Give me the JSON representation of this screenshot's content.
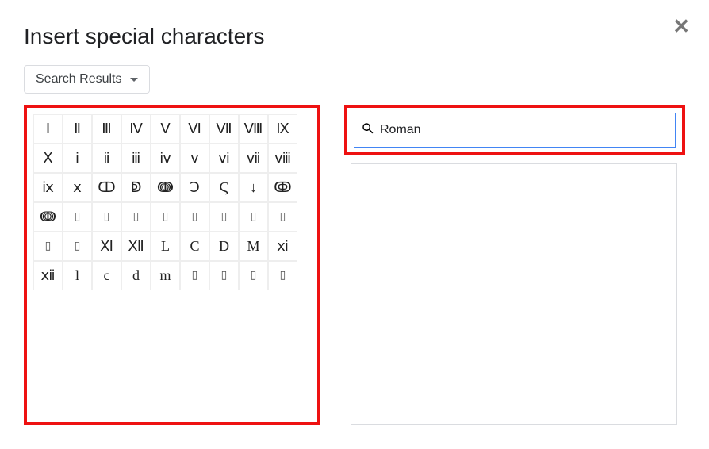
{
  "header": {
    "title": "Insert special characters"
  },
  "dropdown": {
    "label": "Search Results"
  },
  "search": {
    "value": "Roman",
    "placeholder": ""
  },
  "characters": {
    "row1": [
      "Ⅰ",
      "Ⅱ",
      "Ⅲ",
      "Ⅳ",
      "Ⅴ",
      "Ⅵ",
      "Ⅶ",
      "Ⅷ",
      "Ⅸ",
      "Ⅹ"
    ],
    "row2": [
      "ⅰ",
      "ⅱ",
      "ⅲ",
      "ⅳ",
      "ⅴ",
      "ⅵ",
      "ⅶ",
      "ⅷ",
      "ⅸ",
      "ⅹ"
    ],
    "row3": [
      "ↀ",
      "ↁ",
      "ↈ",
      "Ↄ",
      "Ϛ",
      "↓",
      "ↂ",
      "ↈ",
      "▯",
      "▯"
    ],
    "row4": [
      "▯",
      "▯",
      "▯",
      "▯",
      "▯",
      "▯",
      "▯",
      "▯",
      "Ⅺ",
      "Ⅻ"
    ],
    "row5": [
      "L",
      "C",
      "D",
      "M",
      "ⅺ",
      "ⅻ",
      "l",
      "c",
      "d",
      "m"
    ],
    "row6": [
      "▯",
      "▯",
      "▯",
      "▯"
    ]
  }
}
